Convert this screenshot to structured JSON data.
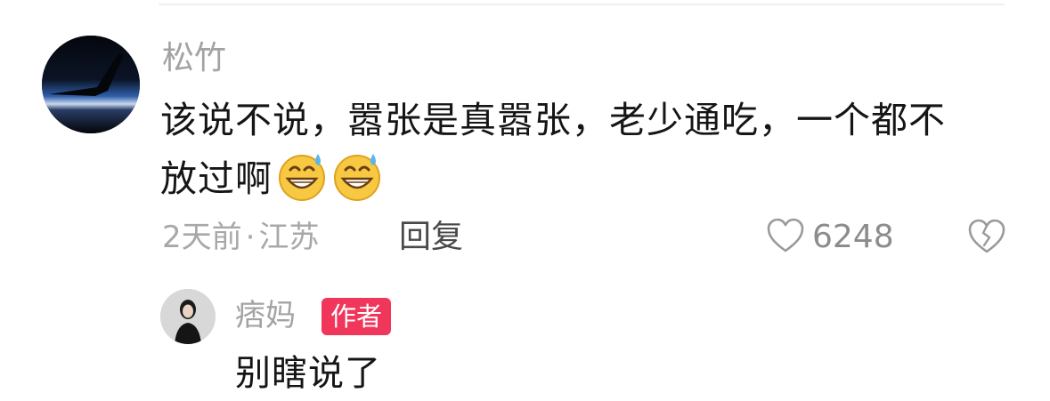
{
  "comment": {
    "username": "松竹",
    "text": "该说不说，嚣张是真嚣张，老少通吃，一个都不放过啊",
    "emojis": [
      "grinning-sweat-emoji",
      "grinning-sweat-emoji"
    ],
    "time": "2天前",
    "separator": "·",
    "location": "江苏",
    "reply_label": "回复",
    "like_count": "6248",
    "icons": {
      "like": "heart-outline-icon",
      "dislike": "broken-heart-icon"
    }
  },
  "reply": {
    "username": "痞妈",
    "badge": "作者",
    "text": "别瞎说了"
  },
  "colors": {
    "badge_bg": "#f0365b",
    "muted_text": "#a3a3a3",
    "body_text": "#151515"
  }
}
